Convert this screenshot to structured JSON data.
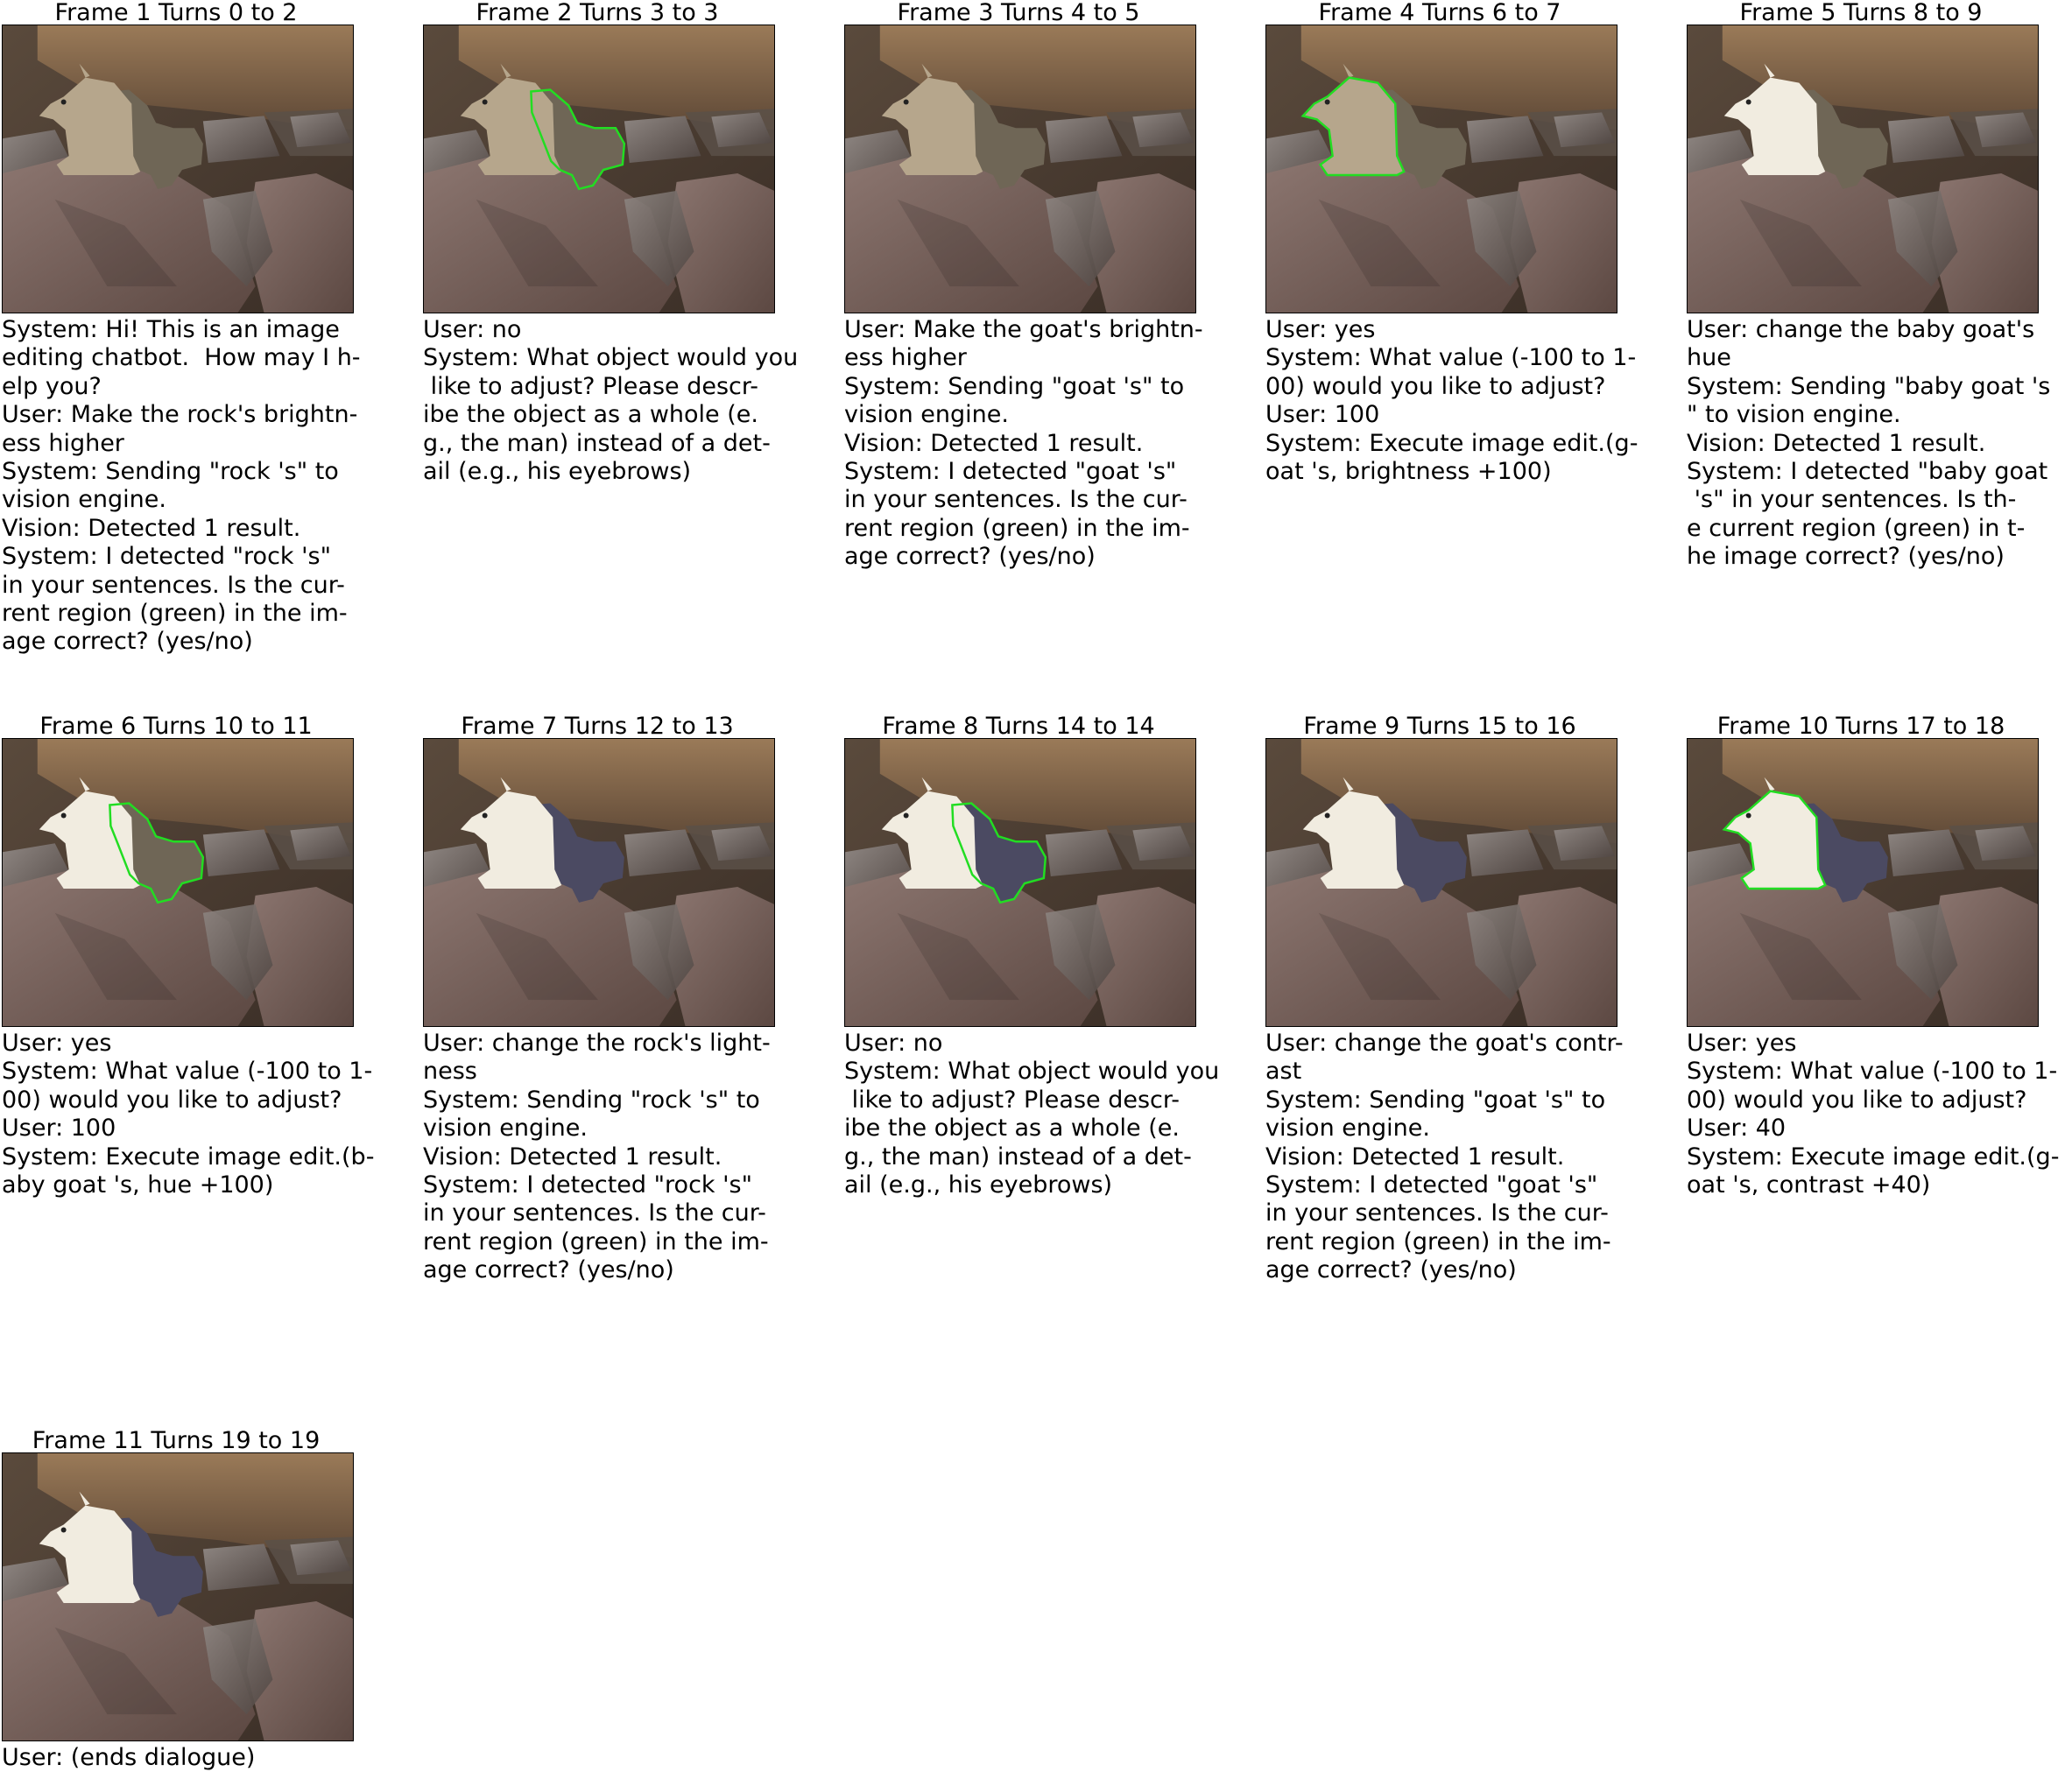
{
  "frames": [
    {
      "title": "Frame 1 Turns 0 to 2",
      "goat_tone": "normal",
      "baby_tone": "normal",
      "highlight": "none",
      "dialogue": "System: Hi! This is an image\nediting chatbot.  How may I h-\nelp you?\nUser: Make the rock's brightn-\ness higher\nSystem: Sending \"rock 's\" to\nvision engine.\nVision: Detected 1 result.\nSystem: I detected \"rock 's\"\nin your sentences. Is the cur-\nrent region (green) in the im-\nage correct? (yes/no)"
    },
    {
      "title": "Frame 2 Turns 3 to 3",
      "goat_tone": "normal",
      "baby_tone": "normal",
      "highlight": "baby",
      "dialogue": "User: no\nSystem: What object would you\n like to adjust? Please descr-\nibe the object as a whole (e.\ng., the man) instead of a det-\nail (e.g., his eyebrows)"
    },
    {
      "title": "Frame 3 Turns 4 to 5",
      "goat_tone": "normal",
      "baby_tone": "normal",
      "highlight": "none",
      "dialogue": "User: Make the goat's brightn-\ness higher\nSystem: Sending \"goat 's\" to\nvision engine.\nVision: Detected 1 result.\nSystem: I detected \"goat 's\"\nin your sentences. Is the cur-\nrent region (green) in the im-\nage correct? (yes/no)"
    },
    {
      "title": "Frame 4 Turns 6 to 7",
      "goat_tone": "normal",
      "baby_tone": "normal",
      "highlight": "goat",
      "dialogue": "User: yes\nSystem: What value (-100 to 1-\n00) would you like to adjust?\nUser: 100\nSystem: Execute image edit.(g-\noat 's, brightness +100)"
    },
    {
      "title": "Frame 5 Turns 8 to 9",
      "goat_tone": "bright",
      "baby_tone": "normal",
      "highlight": "none",
      "dialogue": "User: change the baby goat's\nhue\nSystem: Sending \"baby goat 's\n\" to vision engine.\nVision: Detected 1 result.\nSystem: I detected \"baby goat\n 's\" in your sentences. Is th-\ne current region (green) in t-\nhe image correct? (yes/no)"
    },
    {
      "title": "Frame 6 Turns 10 to 11",
      "goat_tone": "bright",
      "baby_tone": "normal",
      "highlight": "baby",
      "dialogue": "User: yes\nSystem: What value (-100 to 1-\n00) would you like to adjust?\nUser: 100\nSystem: Execute image edit.(b-\naby goat 's, hue +100)"
    },
    {
      "title": "Frame 7 Turns 12 to 13",
      "goat_tone": "bright",
      "baby_tone": "purple",
      "highlight": "none",
      "dialogue": "User: change the rock's light-\nness\nSystem: Sending \"rock 's\" to\nvision engine.\nVision: Detected 1 result.\nSystem: I detected \"rock 's\"\nin your sentences. Is the cur-\nrent region (green) in the im-\nage correct? (yes/no)"
    },
    {
      "title": "Frame 8 Turns 14 to 14",
      "goat_tone": "bright",
      "baby_tone": "purple",
      "highlight": "baby",
      "dialogue": "User: no\nSystem: What object would you\n like to adjust? Please descr-\nibe the object as a whole (e.\ng., the man) instead of a det-\nail (e.g., his eyebrows)"
    },
    {
      "title": "Frame 9 Turns 15 to 16",
      "goat_tone": "bright",
      "baby_tone": "purple",
      "highlight": "none",
      "dialogue": "User: change the goat's contr-\nast\nSystem: Sending \"goat 's\" to\nvision engine.\nVision: Detected 1 result.\nSystem: I detected \"goat 's\"\nin your sentences. Is the cur-\nrent region (green) in the im-\nage correct? (yes/no)"
    },
    {
      "title": "Frame 10 Turns 17 to 18",
      "goat_tone": "bright",
      "baby_tone": "purple",
      "highlight": "goat",
      "dialogue": "User: yes\nSystem: What value (-100 to 1-\n00) would you like to adjust?\nUser: 40\nSystem: Execute image edit.(g-\noat 's, contrast +40)"
    },
    {
      "title": "Frame 11 Turns 19 to 19",
      "goat_tone": "bright",
      "baby_tone": "purple",
      "highlight": "none",
      "dialogue": "User: (ends dialogue)"
    }
  ],
  "colors": {
    "highlight": "#22dd22",
    "goat_normal": "#b6a68c",
    "goat_bright": "#f1ece0",
    "baby_normal": "#6f6656",
    "baby_purple": "#4b4a62",
    "rock_main": "#7b6660",
    "rock_dark": "#4a3a34",
    "cliff_top": "#8a6e50"
  }
}
